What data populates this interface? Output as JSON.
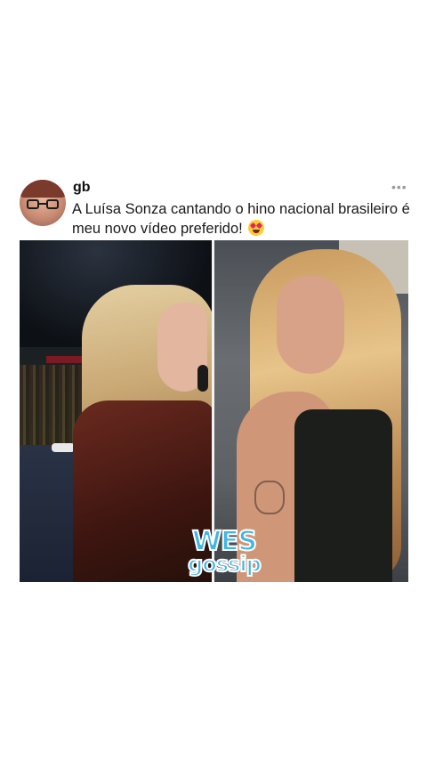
{
  "post": {
    "username": "gb",
    "more_label": "•••",
    "text_line": "A Luísa Sonza cantando o hino nacional brasileiro é meu novo vídeo preferido!",
    "emoji": "heart-eyes-emoji"
  },
  "media": {
    "watermark_top": "WES",
    "watermark_bottom": "gossip"
  },
  "colors": {
    "watermark": "#3fb6ea",
    "background": "#ffffff"
  }
}
